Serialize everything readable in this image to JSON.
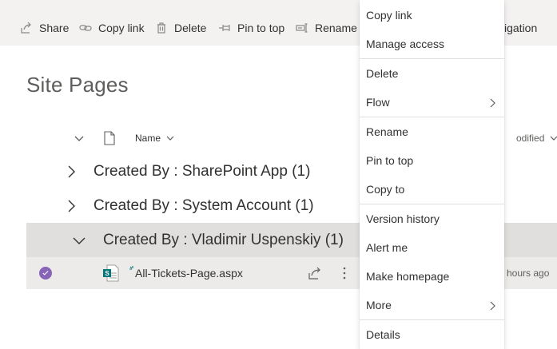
{
  "commandbar": {
    "share": "Share",
    "copy_link": "Copy link",
    "delete": "Delete",
    "pin_to_top": "Pin to top",
    "rename": "Rename",
    "navigation": "igation"
  },
  "page": {
    "title": "Site Pages"
  },
  "list_header": {
    "name": "Name",
    "modified": "odified"
  },
  "groups": [
    {
      "label": "Created By : SharePoint App (1)"
    },
    {
      "label": "Created By : System Account (1)"
    },
    {
      "label": "Created By : Vladimir Uspenskiy (1)"
    }
  ],
  "row": {
    "file_name": "All-Tickets-Page.aspx",
    "modified": "hours ago",
    "selected": true
  },
  "context_menu": {
    "items": [
      {
        "label": "Copy link"
      },
      {
        "label": "Manage access"
      },
      {
        "label": "Delete"
      },
      {
        "label": "Flow"
      },
      {
        "label": "Rename"
      },
      {
        "label": "Pin to top"
      },
      {
        "label": "Copy to"
      },
      {
        "label": "Version history"
      },
      {
        "label": "Alert me"
      },
      {
        "label": "Make homepage"
      },
      {
        "label": "More"
      },
      {
        "label": "Details"
      }
    ]
  },
  "colors": {
    "accent": "#8764b8",
    "sharepoint_green": "#03787c",
    "selected_row": "#edebe9",
    "group_selected": "#e1dfdd"
  }
}
